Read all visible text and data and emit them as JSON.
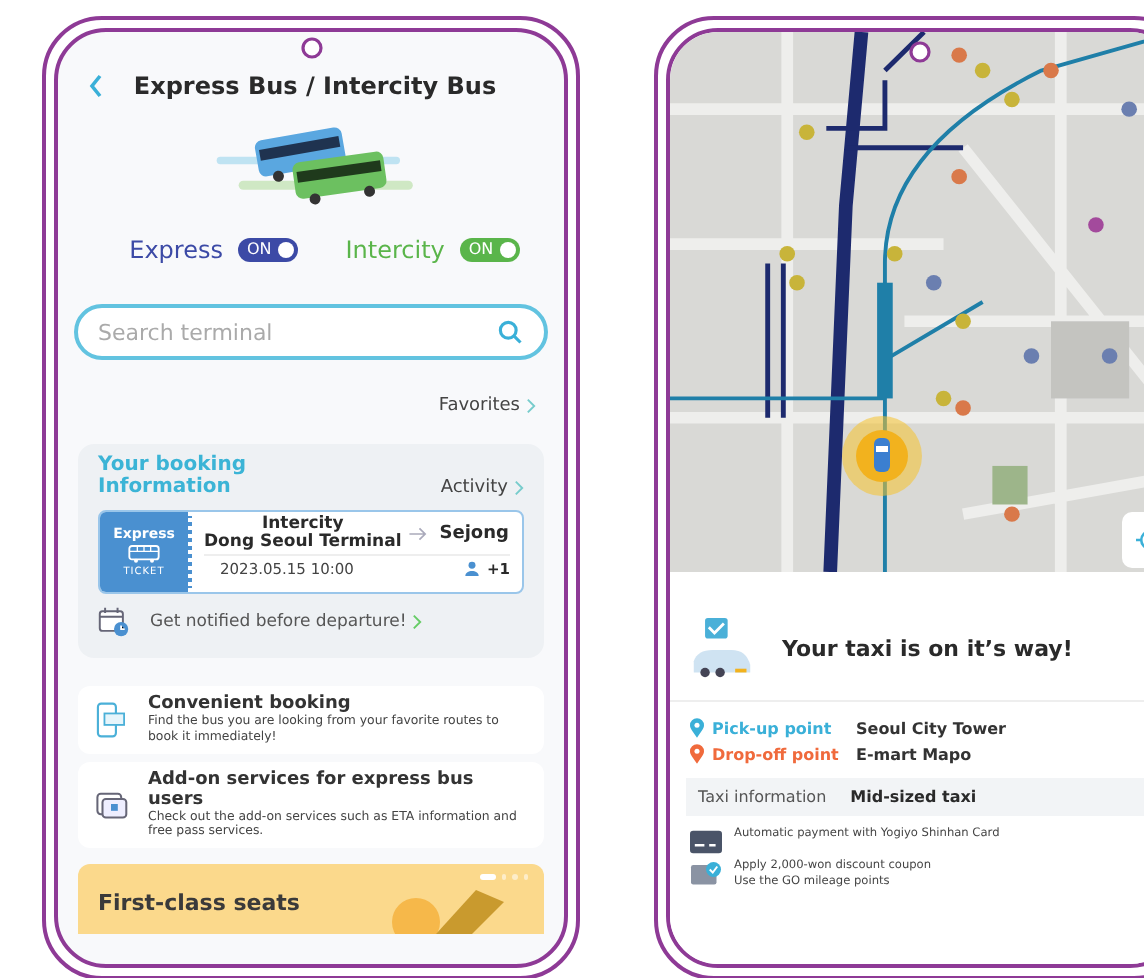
{
  "bus_screen": {
    "title": "Express Bus / Intercity Bus",
    "toggles": [
      {
        "label": "Express",
        "state_text": "ON",
        "on": true,
        "color": "#3c4aa6"
      },
      {
        "label": "Intercity",
        "state_text": "ON",
        "on": true,
        "color": "#5ab54a"
      }
    ],
    "search": {
      "placeholder": "Search terminal"
    },
    "favorites_link": "Favorites",
    "booking": {
      "title": "Your booking Information",
      "activity_link": "Activity",
      "ticket": {
        "type": "Express",
        "stub_label": "TICKET",
        "origin_lines": [
          "Intercity",
          "Dong Seoul Terminal"
        ],
        "destination": "Sejong",
        "datetime": "2023.05.15 10:00",
        "passengers": "+1"
      },
      "notify_link": "Get notified before departure!"
    },
    "features": [
      {
        "kind": "booking",
        "title": "Convenient booking",
        "description": "Find the bus you are looking from your favorite routes to book it immediately!"
      },
      {
        "kind": "addon",
        "title": "Add-on services for express bus users",
        "description": "Check out the add-on services such as ETA information and free pass services."
      }
    ],
    "banner": {
      "title": "First-class seats",
      "pages": [
        {
          "selected": true
        },
        {
          "selected": false
        },
        {
          "selected": false
        },
        {
          "selected": false
        }
      ]
    }
  },
  "taxi_screen": {
    "status_title": "Your taxi is on it’s way!",
    "route": [
      {
        "label": "Pick-up point",
        "value": "Seoul City Tower",
        "color": "#3ab0d8"
      },
      {
        "label": "Drop-off point",
        "value": "E-mart Mapo",
        "color": "#f06a3c"
      }
    ],
    "taxi_info": {
      "label": "Taxi information",
      "value": "Mid-sized taxi"
    },
    "payment": [
      {
        "kind": "card",
        "lines": [
          "Automatic payment with Yogiyo Shinhan Card"
        ]
      },
      {
        "kind": "coupon",
        "lines": [
          "Apply 2,000-won discount coupon",
          "Use the GO mileage points"
        ]
      }
    ]
  }
}
